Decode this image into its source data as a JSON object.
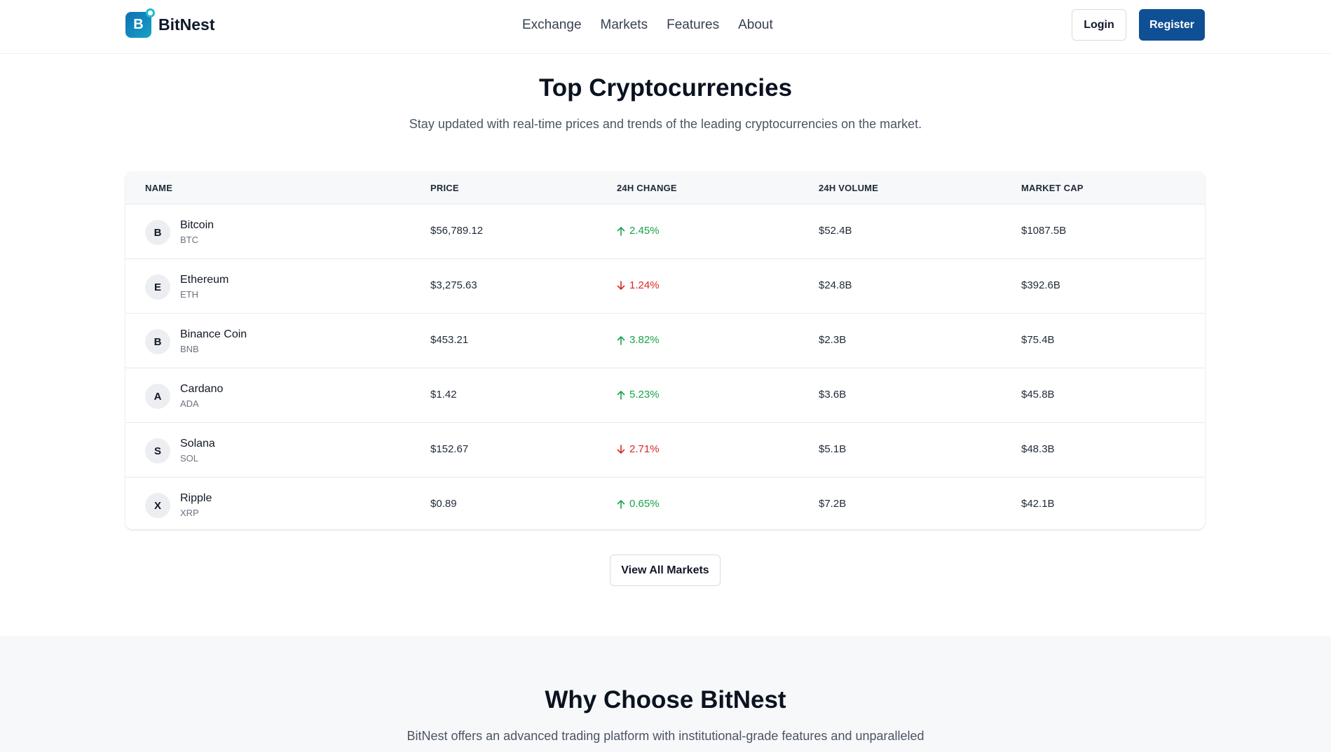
{
  "brand": {
    "logo_letter": "B",
    "name": "BitNest"
  },
  "nav": {
    "links": [
      "Exchange",
      "Markets",
      "Features",
      "About"
    ],
    "login_label": "Login",
    "register_label": "Register"
  },
  "top_section": {
    "title": "Top Cryptocurrencies",
    "subtitle": "Stay updated with real-time prices and trends of the leading cryptocurrencies on the market."
  },
  "table": {
    "columns": [
      "NAME",
      "PRICE",
      "24H CHANGE",
      "24H VOLUME",
      "MARKET CAP"
    ],
    "rows": [
      {
        "initial": "B",
        "name": "Bitcoin",
        "symbol": "BTC",
        "price": "$56,789.12",
        "change": "2.45%",
        "direction": "up",
        "volume": "$52.4B",
        "market_cap": "$1087.5B"
      },
      {
        "initial": "E",
        "name": "Ethereum",
        "symbol": "ETH",
        "price": "$3,275.63",
        "change": "1.24%",
        "direction": "down",
        "volume": "$24.8B",
        "market_cap": "$392.6B"
      },
      {
        "initial": "B",
        "name": "Binance Coin",
        "symbol": "BNB",
        "price": "$453.21",
        "change": "3.82%",
        "direction": "up",
        "volume": "$2.3B",
        "market_cap": "$75.4B"
      },
      {
        "initial": "A",
        "name": "Cardano",
        "symbol": "ADA",
        "price": "$1.42",
        "change": "5.23%",
        "direction": "up",
        "volume": "$3.6B",
        "market_cap": "$45.8B"
      },
      {
        "initial": "S",
        "name": "Solana",
        "symbol": "SOL",
        "price": "$152.67",
        "change": "2.71%",
        "direction": "down",
        "volume": "$5.1B",
        "market_cap": "$48.3B"
      },
      {
        "initial": "X",
        "name": "Ripple",
        "symbol": "XRP",
        "price": "$0.89",
        "change": "0.65%",
        "direction": "up",
        "volume": "$7.2B",
        "market_cap": "$42.1B"
      }
    ]
  },
  "view_all_label": "View All Markets",
  "why_section": {
    "title": "Why Choose BitNest",
    "subtitle": "BitNest offers an advanced trading platform with institutional-grade features and unparalleled"
  },
  "colors": {
    "brand_blue": "#0f4f94",
    "up_green": "#16a34a",
    "down_red": "#dc2626"
  }
}
